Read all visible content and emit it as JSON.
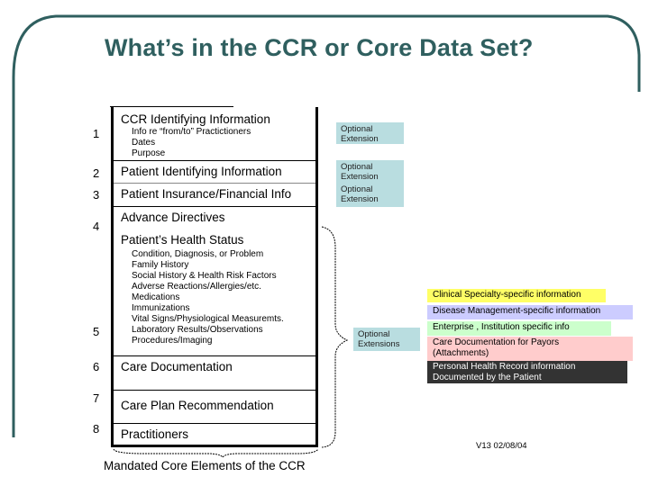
{
  "slide": {
    "title": "What’s in the CCR or Core Data Set?",
    "frame_color": "#2f5f5f"
  },
  "core_elements": [
    {
      "number": "1",
      "label": "CCR Identifying Information",
      "details": [
        "Info re “from/to” Practictioners",
        "Dates",
        "Purpose"
      ]
    },
    {
      "number": "2",
      "label": "Patient Identifying Information",
      "details": []
    },
    {
      "number": "3",
      "label": "Patient Insurance/Financial Info",
      "details": []
    },
    {
      "number": "4",
      "label": "Advance Directives",
      "details": []
    },
    {
      "number": "5",
      "label": "Patient’s Health Status",
      "details": [
        "Condition, Diagnosis, or Problem",
        "Family History",
        "Social History & Health Risk Factors",
        "Adverse Reactions/Allergies/etc.",
        "Medications",
        "Immunizations",
        "Vital Signs/Physiological Measuremts.",
        "Laboratory Results/Observations",
        "Procedures/Imaging"
      ]
    },
    {
      "number": "6",
      "label": "Care Documentation",
      "details": []
    },
    {
      "number": "7",
      "label": "Care Plan Recommendation",
      "details": []
    },
    {
      "number": "8",
      "label": "Practitioners",
      "details": []
    }
  ],
  "optional_extensions": [
    {
      "label": "Optional Extension",
      "line1": "Optional",
      "line2": "Extension"
    },
    {
      "label": "Optional Extension",
      "line1": "Optional",
      "line2": "Extension"
    },
    {
      "label": "Optional Extension",
      "line1": "Optional",
      "line2": "Extension"
    },
    {
      "label": "Optional Extensions",
      "line1": "Optional",
      "line2": "Extensions"
    }
  ],
  "extension_categories": [
    {
      "line1": "Clinical Specialty-specific information",
      "line2": "",
      "color": "#ffff66"
    },
    {
      "line1": "Disease Management-specific information",
      "line2": "",
      "color": "#ccccff"
    },
    {
      "line1": "Enterprise , Institution specific info",
      "line2": "",
      "color": "#ccffcc"
    },
    {
      "line1": "Care Documentation for Payors",
      "line2": "(Attachments)",
      "color": "#ffcccc"
    },
    {
      "line1": "Personal Health Record information",
      "line2": "Documented by the Patient",
      "color": "#333333"
    }
  ],
  "caption": "Mandated Core Elements of the CCR",
  "version": "V13  02/08/04"
}
